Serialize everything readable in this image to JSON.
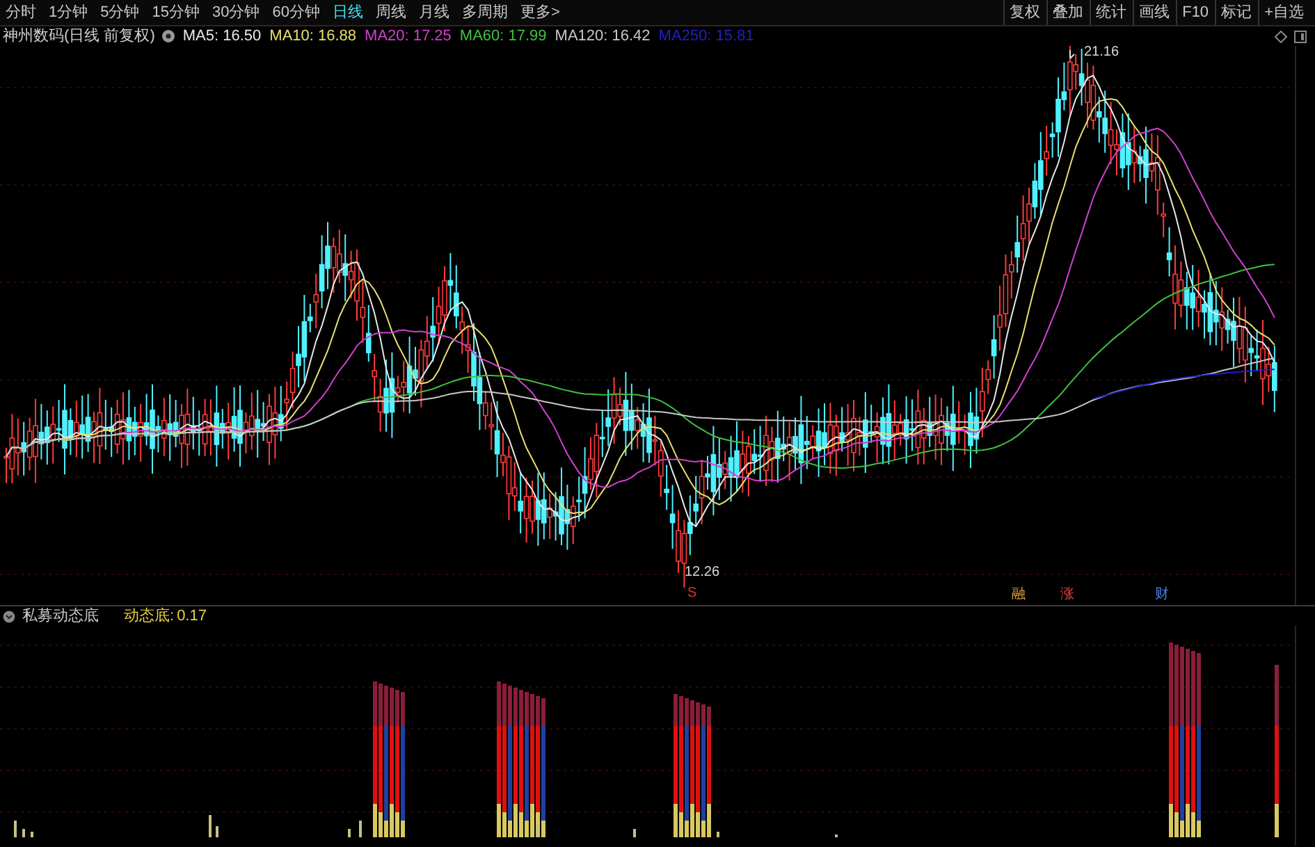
{
  "periods": [
    {
      "label": "分时",
      "selected": false
    },
    {
      "label": "1分钟",
      "selected": false
    },
    {
      "label": "5分钟",
      "selected": false
    },
    {
      "label": "15分钟",
      "selected": false
    },
    {
      "label": "30分钟",
      "selected": false
    },
    {
      "label": "60分钟",
      "selected": false
    },
    {
      "label": "日线",
      "selected": true
    },
    {
      "label": "周线",
      "selected": false
    },
    {
      "label": "月线",
      "selected": false
    },
    {
      "label": "多周期",
      "selected": false
    },
    {
      "label": "更多>",
      "selected": false
    }
  ],
  "tools": [
    "复权",
    "叠加",
    "统计",
    "画线",
    "F10",
    "标记",
    "+自选"
  ],
  "legend": {
    "title": "神州数码(日线 前复权)",
    "ma": [
      {
        "text": "MA5: 16.50",
        "color": "#e8e8e8"
      },
      {
        "text": "MA10: 16.88",
        "color": "#e8e070"
      },
      {
        "text": "MA20: 17.25",
        "color": "#d040d0"
      },
      {
        "text": "MA60: 17.99",
        "color": "#40c040"
      },
      {
        "text": "MA120: 16.42",
        "color": "#c8c8c8"
      },
      {
        "text": "MA250: 15.81",
        "color": "#2020c0"
      }
    ]
  },
  "price_marks": {
    "high": "21.16",
    "low": "12.26"
  },
  "signals": [
    {
      "text": "S",
      "color": "#e03030"
    },
    {
      "text": "融",
      "color": "#e0a040"
    },
    {
      "text": "涨",
      "color": "#e04040"
    },
    {
      "text": "财",
      "color": "#5080e0"
    }
  ],
  "indicator": {
    "title": "私募动态底",
    "label": "动态底:",
    "value": "0.17"
  }
}
